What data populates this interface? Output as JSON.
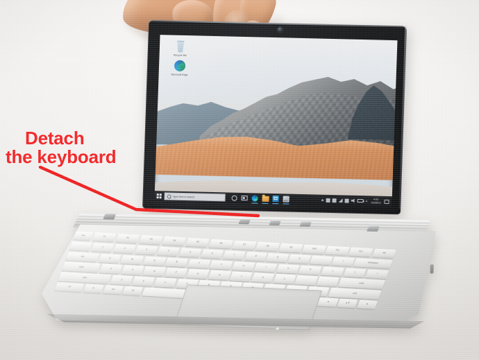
{
  "annotation": {
    "line1": "Detach",
    "line2": "the keyboard",
    "color": "#f41f22",
    "arrow_color": "#ee1c1c"
  },
  "device": {
    "name": "Surface Book detachable laptop",
    "tablet_label": "tablet-screen-unit",
    "keyboard_label": "detachable-keyboard-base",
    "hand_label": "hand-gripping-tablet"
  },
  "desktop": {
    "wallpaper": "Windows 10 mountain dune wallpaper",
    "icons": [
      {
        "name": "recycle-bin-icon",
        "label": "Recycle Bin"
      },
      {
        "name": "edge-icon",
        "label": "Microsoft Edge"
      }
    ]
  },
  "taskbar": {
    "start_label": "Start",
    "search": {
      "placeholder": "Type here to search",
      "value": "Type here to search"
    },
    "pinned": [
      {
        "name": "cortana-icon",
        "label": "Cortana",
        "active": false
      },
      {
        "name": "task-view-icon",
        "label": "Task View",
        "active": false
      },
      {
        "name": "edge-icon",
        "label": "Microsoft Edge",
        "active": true
      },
      {
        "name": "file-explorer-icon",
        "label": "File Explorer",
        "active": true
      },
      {
        "name": "microsoft-store-icon",
        "label": "Microsoft Store",
        "active": true
      },
      {
        "name": "photos-icon",
        "label": "Photos",
        "active": true
      }
    ],
    "tray": [
      {
        "name": "show-hidden-icons-chevron",
        "label": "Show hidden icons"
      },
      {
        "name": "onedrive-icon",
        "label": "OneDrive"
      },
      {
        "name": "surface-app-icon",
        "label": "Surface"
      },
      {
        "name": "network-icon",
        "label": "Network"
      },
      {
        "name": "bluetooth-icon",
        "label": "Bluetooth"
      },
      {
        "name": "pen-icon",
        "label": "Surface Pen"
      },
      {
        "name": "battery-icon",
        "label": "Battery"
      },
      {
        "name": "ime-icon",
        "label": "A"
      }
    ],
    "clock": {
      "time": "4:02",
      "date": "2020/8/14"
    },
    "action_center_label": "Notifications"
  },
  "keyboard": {
    "rows": [
      [
        "esc",
        "F1",
        "F2",
        "F3",
        "F4",
        "F5",
        "F6",
        "F7",
        "F8",
        "F9",
        "F10",
        "F11",
        "F12",
        "del"
      ],
      [
        "~",
        "1",
        "2",
        "3",
        "4",
        "5",
        "6",
        "7",
        "8",
        "9",
        "0",
        "-",
        "=",
        "backspace"
      ],
      [
        "tab",
        "Q",
        "W",
        "E",
        "R",
        "T",
        "Y",
        "U",
        "I",
        "O",
        "P",
        "[",
        "]",
        "\\"
      ],
      [
        "caps",
        "A",
        "S",
        "D",
        "F",
        "G",
        "H",
        "J",
        "K",
        "L",
        ";",
        "'",
        "enter"
      ],
      [
        "shift",
        "Z",
        "X",
        "C",
        "V",
        "B",
        "N",
        "M",
        ",",
        ".",
        "/",
        "shift"
      ],
      [
        "ctrl",
        "fn",
        "win",
        "alt",
        "",
        "alt",
        "ctrl",
        "◄",
        "▲▼",
        "►"
      ]
    ],
    "trackpad_label": "Trackpad"
  }
}
